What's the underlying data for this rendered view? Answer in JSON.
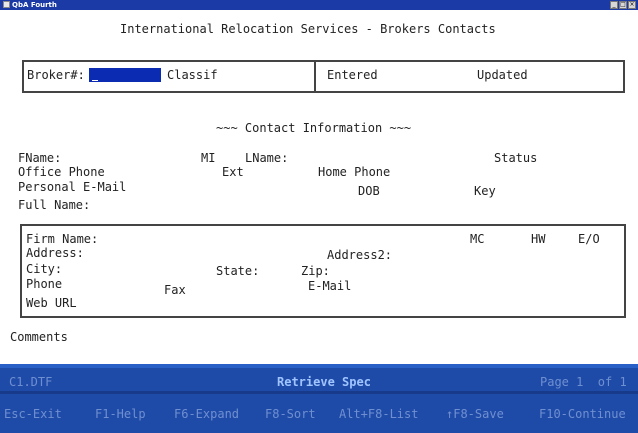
{
  "window": {
    "app_title": "QbA Fourth"
  },
  "screen": {
    "title": "International Relocation Services - Brokers Contacts",
    "header": {
      "broker_label": "Broker#:",
      "classif_label": "Classif",
      "entered_label": "Entered",
      "updated_label": "Updated"
    },
    "contact_heading": "~~~ Contact Information ~~~",
    "contact": {
      "fname_label": "FName:",
      "mi_label": "MI",
      "lname_label": "LName:",
      "status_label": "Status",
      "office_phone_label": "Office Phone",
      "ext_label": "Ext",
      "home_phone_label": "Home Phone",
      "personal_email_label": "Personal E-Mail",
      "dob_label": "DOB",
      "key_label": "Key",
      "full_name_label": "Full Name:"
    },
    "firm": {
      "firm_name_label": "Firm Name:",
      "mc_label": "MC",
      "hw_label": "HW",
      "eo_label": "E/O",
      "address_label": "Address:",
      "address2_label": "Address2:",
      "city_label": "City:",
      "state_label": "State:",
      "zip_label": "Zip:",
      "phone_label": "Phone",
      "fax_label": "Fax",
      "email_label": "E-Mail",
      "web_url_label": "Web URL"
    },
    "comments_label": "Comments"
  },
  "status": {
    "file": "C1.DTF",
    "mode": "Retrieve Spec",
    "page": "Page 1  of 1"
  },
  "function_keys": [
    "Esc-Exit",
    "F1-Help",
    "F6-Expand",
    "F8-Sort",
    "Alt+F8-List",
    "↑F8-Save",
    "F10-Continue"
  ],
  "colors": {
    "title_bar": "#1c3aa5",
    "status_bar": "#1f4ba8",
    "field_highlight": "#0c2bb3",
    "status_text": "#6f8fd0",
    "status_mode_text": "#9fc4ff"
  }
}
